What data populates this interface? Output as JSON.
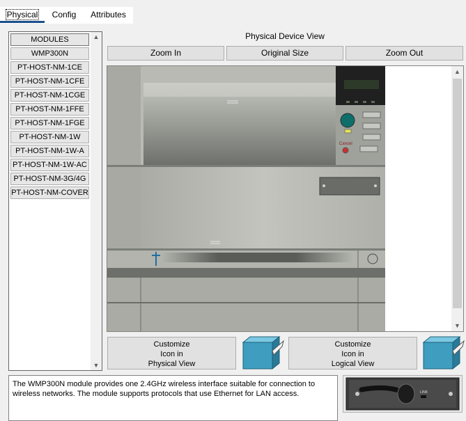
{
  "tabs": [
    {
      "label": "Physical",
      "active": true
    },
    {
      "label": "Config",
      "active": false
    },
    {
      "label": "Attributes",
      "active": false
    }
  ],
  "modules": {
    "header": "MODULES",
    "items": [
      "WMP300N",
      "PT-HOST-NM-1CE",
      "PT-HOST-NM-1CFE",
      "PT-HOST-NM-1CGE",
      "PT-HOST-NM-1FFE",
      "PT-HOST-NM-1FGE",
      "PT-HOST-NM-1W",
      "PT-HOST-NM-1W-A",
      "PT-HOST-NM-1W-AC",
      "PT-HOST-NM-3G/4G",
      "PT-HOST-NM-COVER"
    ]
  },
  "device_view": {
    "title": "Physical Device View",
    "zoom_in": "Zoom In",
    "original_size": "Original Size",
    "zoom_out": "Zoom Out",
    "cancel_label": "Cancel"
  },
  "customize": {
    "physical": "Customize\nIcon in\nPhysical View",
    "logical": "Customize\nIcon in\nLogical View"
  },
  "description": "The WMP300N module provides one 2.4GHz wireless interface suitable for connection to wireless networks. The module supports protocols that use Ethernet for LAN access.",
  "module_thumb": {
    "link_label": "LINK"
  },
  "colors": {
    "tab_underline": "#1b4f8a",
    "device_body": "#b8bab3",
    "cube": "#3f9ec0"
  }
}
